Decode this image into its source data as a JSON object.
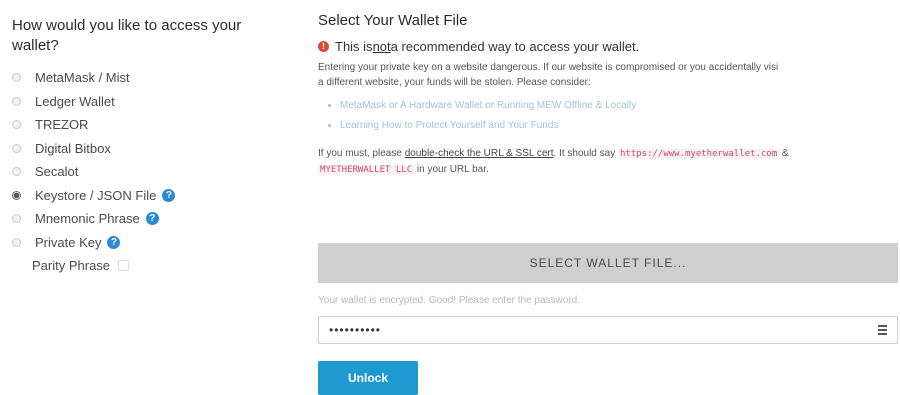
{
  "access": {
    "title": "How would you like to access your wallet?",
    "options": [
      {
        "label": "MetaMask / Mist",
        "checked": false,
        "help": false
      },
      {
        "label": "Ledger Wallet",
        "checked": false,
        "help": false
      },
      {
        "label": "TREZOR",
        "checked": false,
        "help": false
      },
      {
        "label": "Digital Bitbox",
        "checked": false,
        "help": false
      },
      {
        "label": "Secalot",
        "checked": false,
        "help": false
      },
      {
        "label": "Keystore / JSON File",
        "checked": true,
        "help": true
      },
      {
        "label": "Mnemonic Phrase",
        "checked": false,
        "help": true
      },
      {
        "label": "Private Key",
        "checked": false,
        "help": true
      }
    ],
    "parity_label": "Parity Phrase"
  },
  "wallet_file": {
    "title": "Select Your Wallet File",
    "warning_prefix": "This is ",
    "warning_emph": "not",
    "warning_suffix": " a recommended way to access your wallet.",
    "body_line1": "Entering your private key on a website dangerous. If our website is compromised or you accidentally visi",
    "body_line2": "a different website, your funds will be stolen. Please consider:",
    "consider": [
      "MetaMask or A Hardware Wallet or Running MEW Offline & Locally",
      "Learning How to Protect Yourself and Your Funds"
    ],
    "must_prefix": "If you must, please ",
    "must_link": "double-check the URL & SSL cert",
    "must_mid": ". It should say ",
    "url_code": "https://www.myetherwallet.com",
    "amp": " &",
    "llc_code": "MYETHERWALLET LLC",
    "must_suffix": " in your URL bar.",
    "select_button": "SELECT WALLET FILE...",
    "encrypted_text": "Your wallet is encrypted. Good! Please enter the password.",
    "password_value": "••••••••••",
    "unlock_button": "Unlock"
  },
  "colors": {
    "accent": "#1f9ad1",
    "help": "#2a8ad7",
    "warning": "#d64b3b",
    "select_button_bg": "#cfcfcf"
  }
}
